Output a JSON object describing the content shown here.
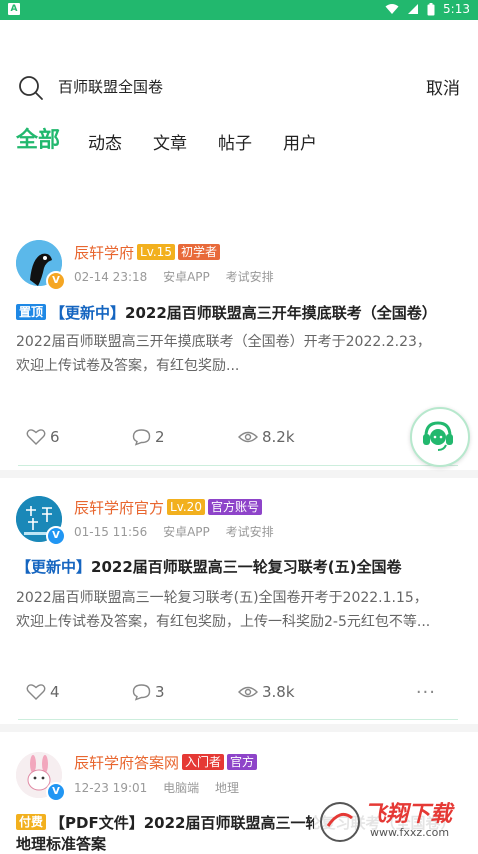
{
  "status_bar": {
    "app_badge": "A",
    "time": "5:13",
    "accent": "#22b86e"
  },
  "search": {
    "query": "百师联盟全国卷",
    "cancel_label": "取消"
  },
  "tabs": [
    {
      "label": "全部",
      "active": true
    },
    {
      "label": "动态",
      "active": false
    },
    {
      "label": "文章",
      "active": false
    },
    {
      "label": "帖子",
      "active": false
    },
    {
      "label": "用户",
      "active": false
    }
  ],
  "posts": [
    {
      "author": "辰轩学府",
      "level": "Lv.15",
      "role": "初学者",
      "time": "02-14 23:18",
      "platform": "安卓APP",
      "category": "考试安排",
      "title_label": "置顶",
      "title_highlight": "【更新中】",
      "title": "2022届百师联盟高三开年摸底联考（全国卷）",
      "body_line1": "2022届百师联盟高三开年摸底联考（全国卷）开考于2022.2.23，",
      "body_line2": "欢迎上传试卷及答案，有红包奖励...",
      "likes": "6",
      "comments": "2",
      "views": "8.2k"
    },
    {
      "author": "辰轩学府官方",
      "level": "Lv.20",
      "role": "官方账号",
      "time": "01-15 11:56",
      "platform": "安卓APP",
      "category": "考试安排",
      "title_highlight": "【更新中】",
      "title": "2022届百师联盟高三一轮复习联考(五)全国卷",
      "body_line1": "2022届百师联盟高三一轮复习联考(五)全国卷开考于2022.1.15，",
      "body_line2": "欢迎上传试卷及答案，有红包奖励，上传一科奖励2-5元红包不等...",
      "likes": "4",
      "comments": "3",
      "views": "3.8k",
      "more": "···"
    },
    {
      "author": "辰轩学府答案网",
      "role": "入门者",
      "badge": "官方",
      "time": "12-23 19:01",
      "platform": "电脑端",
      "category": "地理",
      "title_label": "付费",
      "title": "【PDF文件】2022届百师联盟高三一轮复习联考（全国卷）",
      "title_line2": "地理标准答案"
    }
  ],
  "watermark": {
    "title": "飞翔下载",
    "url": "www.fxxz.com"
  }
}
